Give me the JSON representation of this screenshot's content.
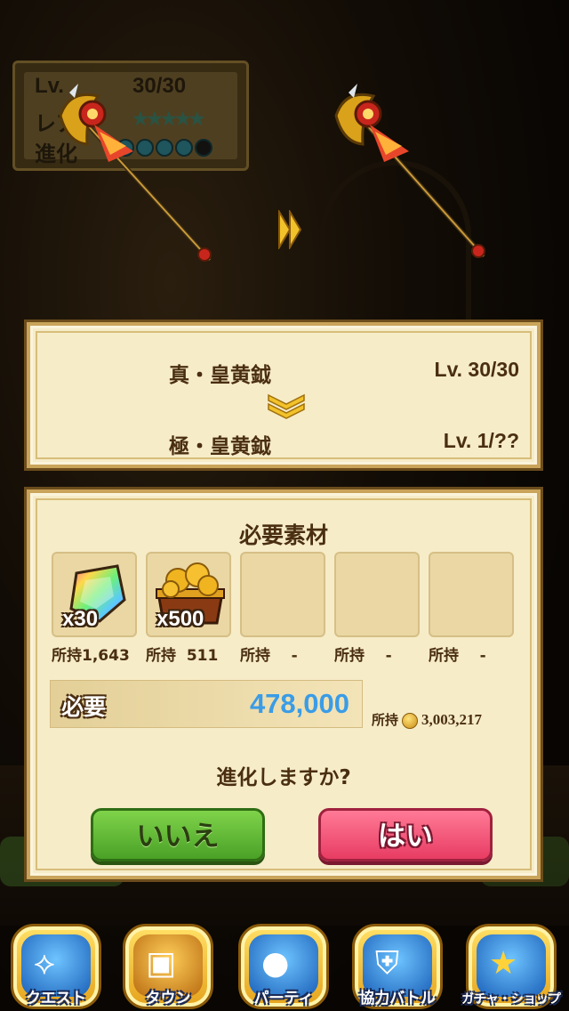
{
  "status": {
    "rows": [
      {
        "label": "Lv.",
        "value": "30/30"
      },
      {
        "label": "レア",
        "value": "★★★★★"
      },
      {
        "label": "進化",
        "value": ""
      }
    ]
  },
  "evolution": {
    "from_name": "真・皇黄鉞",
    "from_level": "Lv. 30/30",
    "to_name": "極・皇黄鉞",
    "to_level": "Lv. 1/??"
  },
  "materials": {
    "title": "必要素材",
    "slots": [
      {
        "icon": "rainbow-crystal-icon",
        "count": "x30",
        "owned": "所持1,643"
      },
      {
        "icon": "gold-chest-icon",
        "count": "x500",
        "owned": "所持  511"
      },
      {
        "icon": "",
        "count": "",
        "owned": "所持    -"
      },
      {
        "icon": "",
        "count": "",
        "owned": "所持    -"
      },
      {
        "icon": "",
        "count": "",
        "owned": "所持    -"
      }
    ]
  },
  "cost": {
    "label": "必要",
    "value": "478,000",
    "owned_label": "所持",
    "owned_value": "3,003,217"
  },
  "dialog": {
    "question": "進化しますか?",
    "no_label": "いいえ",
    "yes_label": "はい"
  },
  "nav": [
    {
      "label": "クエスト",
      "icon": "quest-map-icon"
    },
    {
      "label": "タウン",
      "icon": "town-treasure-icon"
    },
    {
      "label": "パーティ",
      "icon": "party-group-icon"
    },
    {
      "label": "協力バトル",
      "icon": "coop-battle-shield-icon"
    },
    {
      "label": "ガチャ・ショップ",
      "icon": "gacha-star-icon"
    }
  ]
}
